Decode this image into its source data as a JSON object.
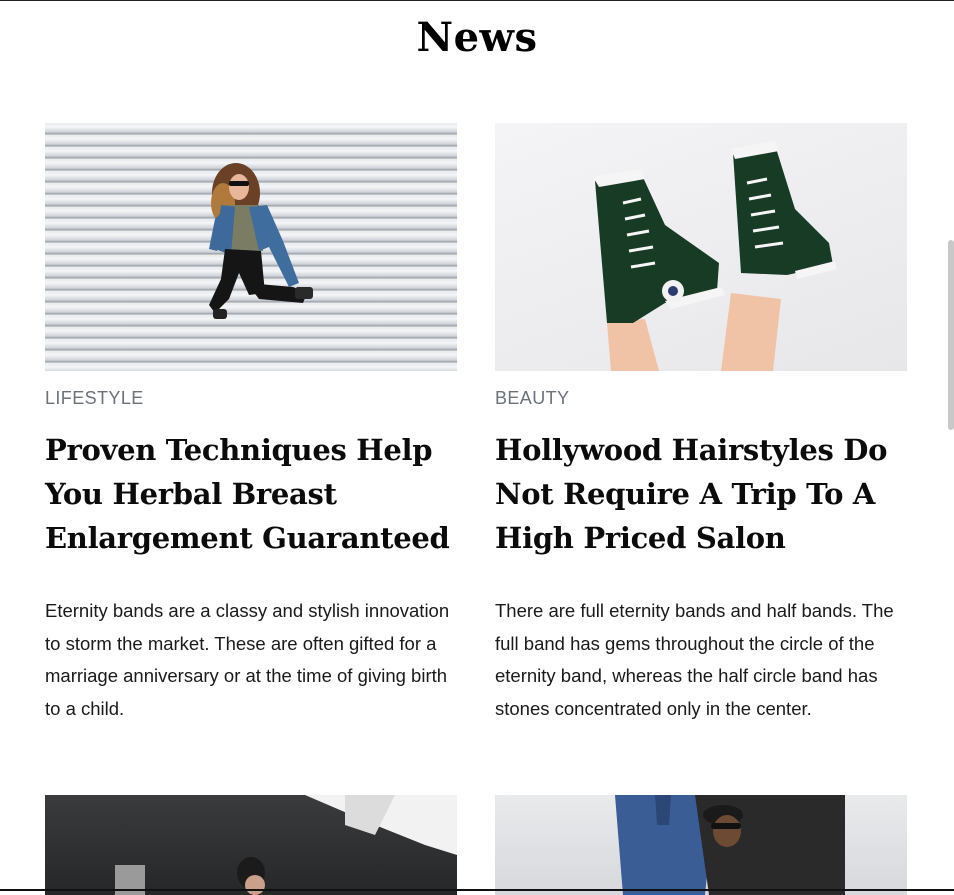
{
  "page": {
    "title": "News"
  },
  "articles": [
    {
      "image_alt": "Woman jumping in front of a striped shutter",
      "category": "LIFESTYLE",
      "title": "Proven Techniques Help You Herbal Breast Enlargement Guaranteed",
      "excerpt": "Eternity bands are a classy and stylish innovation to storm the market. These are often gifted for a marriage anniversary or at the time of giving birth to a child."
    },
    {
      "image_alt": "Legs in black high-top sneakers",
      "category": "BEAUTY",
      "title": "Hollywood Hairstyles Do Not Require A Trip To A High Priced Salon",
      "excerpt": "There are full eternity bands and half bands. The full band has gems throughout the circle of the eternity band, whereas the half circle band has stones concentrated only in the center."
    },
    {
      "image_alt": "Dark photo of a person in a white jacket"
    },
    {
      "image_alt": "Two people in denim posing"
    }
  ]
}
